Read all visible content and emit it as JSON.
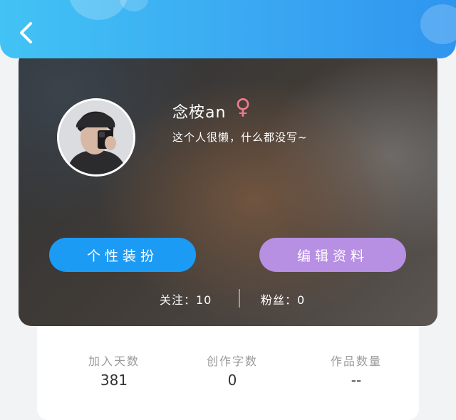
{
  "header": {
    "back_icon": "chevron-left-icon"
  },
  "profile": {
    "username": "念桉an",
    "gender_symbol": "♀",
    "bio": "这个人很懒，什么都没写~",
    "colors": {
      "gender": "#f27b8f",
      "style_button": "#1c9bf5",
      "edit_button": "#b78fe3"
    }
  },
  "actions": {
    "style_label": "个性装扮",
    "edit_label": "编辑资料"
  },
  "social": {
    "follow_label": "关注：10",
    "fans_label": "粉丝：0"
  },
  "stats": [
    {
      "label": "加入天数",
      "value": "381"
    },
    {
      "label": "创作字数",
      "value": "0"
    },
    {
      "label": "作品数量",
      "value": "--"
    }
  ]
}
